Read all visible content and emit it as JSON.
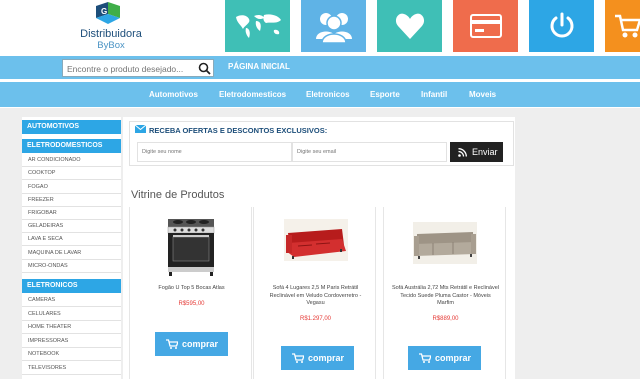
{
  "logo": {
    "name": "Distribuidora",
    "sub": "ByBox"
  },
  "header_tiles": [
    {
      "icon": "world-map-icon",
      "color": "#3fbfb6"
    },
    {
      "icon": "users-icon",
      "color": "#5fb3e6"
    },
    {
      "icon": "heart-icon",
      "color": "#3fbfb6"
    },
    {
      "icon": "credit-card-icon",
      "color": "#ef6c4c"
    },
    {
      "icon": "power-icon",
      "color": "#2da6e5"
    },
    {
      "icon": "cart-icon",
      "color": "#f4901e"
    }
  ],
  "search": {
    "placeholder": "Encontre o produto desejado..."
  },
  "top_nav": {
    "home": "PÁGINA INICIAL"
  },
  "categories": [
    "Automotivos",
    "Eletrodomesticos",
    "Eletronicos",
    "Esporte",
    "Infantil",
    "Moveis"
  ],
  "sidebar": {
    "groups": [
      {
        "title": "AUTOMOTIVOS",
        "items": []
      },
      {
        "title": "ELETRODOMESTICOS",
        "items": [
          "AR CONDICIONADO",
          "COOKTOP",
          "FOGAO",
          "FREEZER",
          "FRIGOBAR",
          "GELADEIRAS",
          "LAVA E SECA",
          "MAQUINA DE LAVAR",
          "MICRO-ONDAS"
        ]
      },
      {
        "title": "ELETRONICOS",
        "items": [
          "CAMERAS",
          "CELULARES",
          "HOME THEATER",
          "IMPRESSORAS",
          "NOTEBOOK",
          "TELEVISORES"
        ]
      }
    ]
  },
  "newsletter": {
    "title": "RECEBA OFERTAS E DESCONTOS EXCLUSIVOS:",
    "name_placeholder": "Digite seu nome",
    "email_placeholder": "Digite seu email",
    "send_label": "Enviar"
  },
  "showcase_title": "Vitrine de Produtos",
  "products": [
    {
      "name": "Fogão U Top 5 Bocas Atlas",
      "price": "R$595,00",
      "buy_label": "comprar"
    },
    {
      "name": "Sofá 4 Lugares 2,5 M Paris Retrátil Reclinável em Veludo Cordoverretro - Vegasu",
      "price": "R$1.297,00",
      "buy_label": "comprar"
    },
    {
      "name": "Sofá Austrália 2,72 Mts Retrátil e Reclinável Tecido Suede Pluma Castor - Móveis Marfim",
      "price": "R$889,00",
      "buy_label": "comprar"
    }
  ],
  "colors": {
    "accent": "#6cc0ec",
    "sidebar_head": "#2da6e5",
    "button": "#45a8e4",
    "price": "#e53935"
  }
}
